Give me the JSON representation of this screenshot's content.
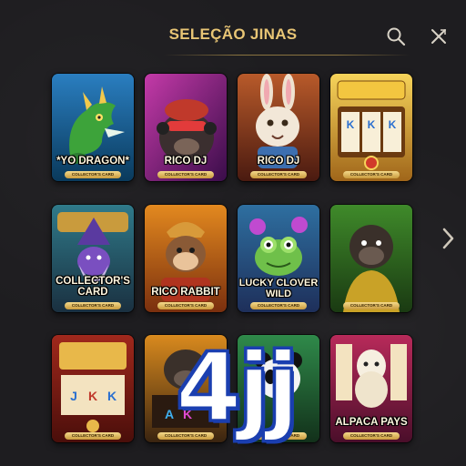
{
  "header": {
    "title": "SELEÇÃO JINAS",
    "search_icon": "search-icon",
    "close_icon": "close-icon"
  },
  "games": [
    {
      "name": "*YO DRAGON*",
      "badge": "COLLECTOR'S CARD",
      "theme": "dragon"
    },
    {
      "name": "RICO DJ",
      "badge": "COLLECTOR'S CARD",
      "theme": "gorilla-dj"
    },
    {
      "name": "RICO DJ",
      "badge": "COLLECTOR'S CARD",
      "theme": "rabbit-dj"
    },
    {
      "name": "",
      "badge": "COLLECTOR'S CARD",
      "theme": "slot-gold"
    },
    {
      "name": "COLLECTOR'S CARD",
      "badge": "COLLECTOR'S CARD",
      "theme": "wizard"
    },
    {
      "name": "RICO RABBIT",
      "badge": "COLLECTOR'S CARD",
      "theme": "monkey"
    },
    {
      "name": "LUCKY CLOVER WILD",
      "badge": "COLLECTOR'S CARD",
      "theme": "frog"
    },
    {
      "name": "",
      "badge": "COLLECTOR'S CARD",
      "theme": "gorilla-green"
    },
    {
      "name": "",
      "badge": "COLLECTOR'S CARD",
      "theme": "slot-red"
    },
    {
      "name": "",
      "badge": "COLLECTOR'S CARD",
      "theme": "gorilla-slot"
    },
    {
      "name": "",
      "badge": "COLLECTOR'S CARD",
      "theme": "panda"
    },
    {
      "name": "ALPACA PAYS",
      "badge": "COLLECTOR'S CARD",
      "theme": "alpaca"
    }
  ],
  "next_icon": "chevron-right-icon",
  "watermark": "4jj",
  "colors": {
    "accent": "#e8c575",
    "background": "#1e1d20",
    "watermark_stroke": "#1b3fb0"
  }
}
